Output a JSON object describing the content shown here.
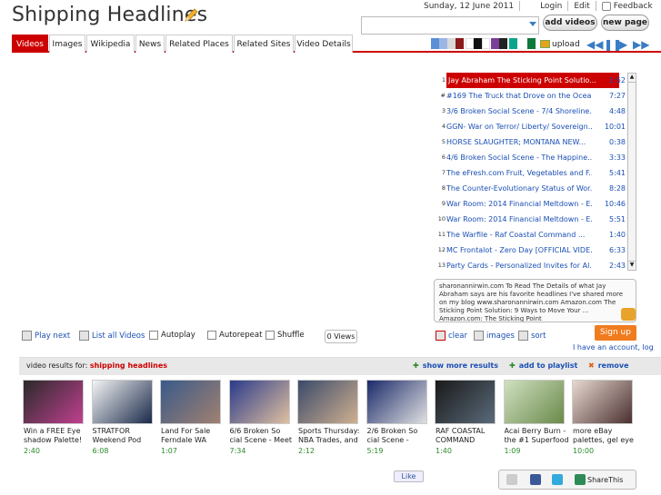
{
  "header": {
    "title": "Shipping Headlines",
    "date": "Sunday, 12 June 2011",
    "login": "Login",
    "edit": "Edit",
    "feedback": "Feedback",
    "add_videos": "add videos",
    "new_page": "new page"
  },
  "tabs": [
    "Videos",
    "Images",
    "Wikipedia",
    "News",
    "Related Places",
    "Related Sites",
    "Video Details"
  ],
  "toolbar": {
    "upload": "upload",
    "swatch_colors": [
      "#5b8fd8",
      "#9db5e4",
      "#d9d9d9",
      "#8b1a1a",
      "#ffffff",
      "#111111",
      "#ffffff",
      "#7a3f9a",
      "#222222",
      "#0aa58a",
      "#0e7a3c"
    ]
  },
  "playlist": [
    {
      "n": "1",
      "title": "Jay Abraham The Sticking Point Solutio...",
      "dur": "1:52"
    },
    {
      "n": "#",
      "title": "#169 The Truck that Drove on the Ocea...",
      "dur": "7:27"
    },
    {
      "n": "3",
      "title": "3/6 Broken Social Scene - 7/4 Shoreline...",
      "dur": "4:48"
    },
    {
      "n": "4",
      "title": "GGN- War on Terror/ Liberty/ Sovereign...",
      "dur": "10:01"
    },
    {
      "n": "5",
      "title": "HORSE SLAUGHTER; MONTANA NEW...",
      "dur": "0:38"
    },
    {
      "n": "6",
      "title": "4/6 Broken Social Scene - The Happine...",
      "dur": "3:33"
    },
    {
      "n": "7",
      "title": "The eFresh.com Fruit, Vegetables and F...",
      "dur": "5:41"
    },
    {
      "n": "8",
      "title": "The Counter-Evolutionary Status of Wor...",
      "dur": "8:28"
    },
    {
      "n": "9",
      "title": "War Room: 2014 Financial Meltdown - E...",
      "dur": "10:46"
    },
    {
      "n": "10",
      "title": "War Room: 2014 Financial Meltdown - E...",
      "dur": "5:51"
    },
    {
      "n": "11",
      "title": "The Warfile - Raf Coastal Command     ...",
      "dur": "1:40"
    },
    {
      "n": "12",
      "title": "MC Frontalot - Zero Day [OFFICIAL VIDE...",
      "dur": "6:33"
    },
    {
      "n": "13",
      "title": "Party Cards - Personalized Invites for Al...",
      "dur": "2:43"
    }
  ],
  "description": "sharonannirwin.com To Read The Details of what Jay Abraham says are his favorite headlines I've shared more on my blog www.sharonannirwin.com Amazon.com The Sticking Point Solution: 9 Ways to Move Your ... Amazon.com: The Sticking Point",
  "controls": {
    "play_next": "Play next",
    "list_all": "List all Videos",
    "autoplay": "Autoplay",
    "autorepeat": "Autorepeat",
    "shuffle": "Shuffle",
    "views": "0 Views",
    "clear": "clear",
    "images": "images",
    "sort": "sort",
    "signup": "Sign up",
    "account": "I have an account, log"
  },
  "results": {
    "label": "video results for:",
    "query": "shipping headlines",
    "show_more": "show more results",
    "add_playlist": "add to playlist",
    "remove": "remove"
  },
  "videos": [
    {
      "title": "Win a FREE Eye shadow Palette!",
      "dur": "2:40"
    },
    {
      "title": "STRATFOR Weekend Pod",
      "dur": "6:08"
    },
    {
      "title": "Land For Sale Ferndale WA",
      "dur": "1:07"
    },
    {
      "title": "6/6 Broken So cial Scene - Meet",
      "dur": "7:34"
    },
    {
      "title": "Sports Thursday: NBA Trades, and",
      "dur": "2:12"
    },
    {
      "title": "2/6 Broken So cial Scene -",
      "dur": "5:19"
    },
    {
      "title": "RAF COASTAL COMMAND",
      "dur": "1:40"
    },
    {
      "title": "Acai Berry Burn - the #1 Superfood",
      "dur": "1:09"
    },
    {
      "title": "more eBay palettes, gel eye",
      "dur": "10:00"
    }
  ],
  "footer": {
    "like": "Like",
    "sharethis": "ShareThis"
  }
}
